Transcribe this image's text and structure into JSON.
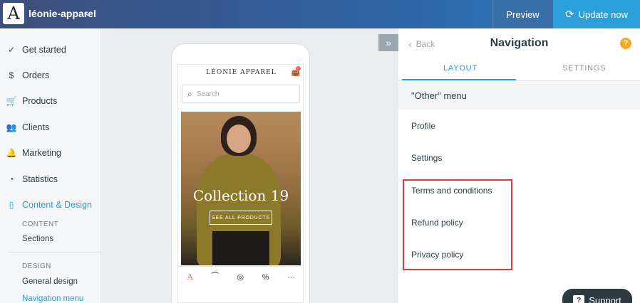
{
  "topbar": {
    "logo_letter": "A",
    "store_name": "léonie-apparel",
    "preview_label": "Preview",
    "update_label": "Update now"
  },
  "sidebar": {
    "items": [
      {
        "label": "Get started",
        "icon": "check-circle-icon"
      },
      {
        "label": "Orders",
        "icon": "dollar-circle-icon"
      },
      {
        "label": "Products",
        "icon": "cart-icon"
      },
      {
        "label": "Clients",
        "icon": "people-icon"
      },
      {
        "label": "Marketing",
        "icon": "bell-icon"
      },
      {
        "label": "Statistics",
        "icon": "pie-chart-icon"
      },
      {
        "label": "Content & Design",
        "icon": "mobile-icon"
      }
    ],
    "content_head": "CONTENT",
    "sections_label": "Sections",
    "design_head": "DESIGN",
    "general_design_label": "General design",
    "navigation_menu_label": "Navigation menu"
  },
  "preview": {
    "brand": "LÉONIE APPAREL",
    "search_placeholder": "Search",
    "hero_title": "Collection 19",
    "hero_cta": "SEE ALL PRODUCTS"
  },
  "panel": {
    "back_label": "Back",
    "title": "Navigation",
    "tabs": [
      {
        "label": "LAYOUT"
      },
      {
        "label": "SETTINGS"
      }
    ],
    "section_title": "\"Other\" menu",
    "menu_items": [
      {
        "label": "Profile"
      },
      {
        "label": "Settings"
      },
      {
        "label": "Terms and conditions"
      },
      {
        "label": "Refund policy"
      },
      {
        "label": "Privacy policy"
      }
    ]
  },
  "support": {
    "label": "Support"
  },
  "colors": {
    "accent": "#2a9cd7",
    "highlight": "#e03a3a",
    "help": "#f5a623"
  }
}
